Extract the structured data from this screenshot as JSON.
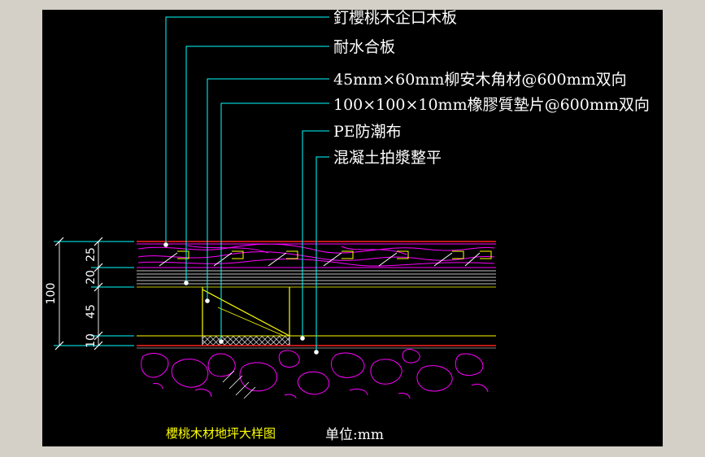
{
  "callouts": [
    "釘櫻桃木企口木板",
    "耐水合板",
    "45mm×60mm柳安木角材@600mm双向",
    "100×100×10mm橡膠質墊片@600mm双向",
    "PE防潮布",
    "混凝土拍漿整平"
  ],
  "dimensions": {
    "total": "100",
    "layers": [
      "25",
      "20",
      "45",
      "10"
    ]
  },
  "title": "櫻桃木材地坪大样图",
  "unit": "单位:mm",
  "colors": {
    "background": "#000000",
    "frame": "#d4d0c8",
    "leader": "#00ffff",
    "leader_dot": "#ffffff",
    "wood_grain": "#ff00ff",
    "batten": "#ffff00",
    "pad_hatch": "#ffffff",
    "concrete": "#ff00ff",
    "ground_line": "#ff0000",
    "title": "#ffff00",
    "text": "#ffffff"
  }
}
